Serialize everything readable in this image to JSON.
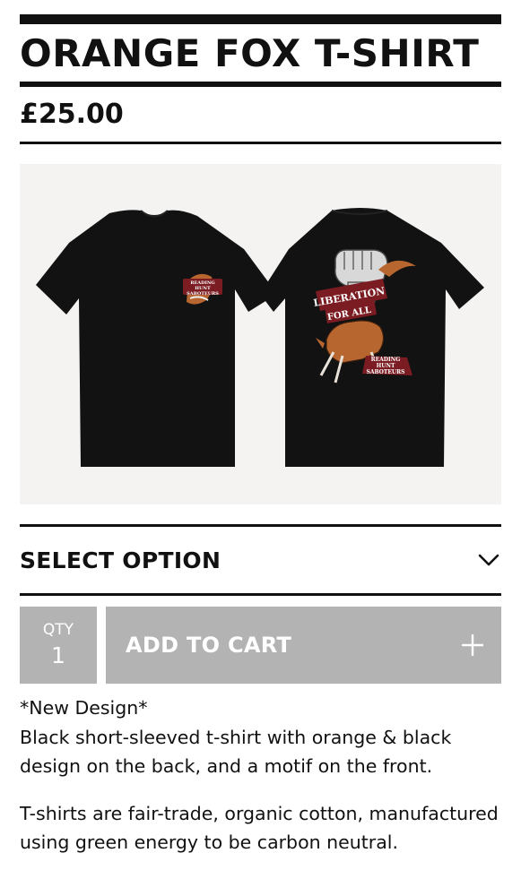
{
  "product": {
    "title": "ORANGE FOX T-SHIRT",
    "price": "£25.00",
    "image": {
      "front_patch": [
        "READING",
        "HUNT",
        "SABOTEURS"
      ],
      "back_banner": [
        "LIBERATION",
        "FOR ALL"
      ],
      "back_footer": [
        "READING",
        "HUNT",
        "SABOTEURS"
      ]
    }
  },
  "options": {
    "select_label": "SELECT OPTION",
    "chevron_icon": "chevron-down-icon"
  },
  "cart": {
    "qty_label": "QTY",
    "qty_value": "1",
    "add_label": "ADD TO CART",
    "add_icon": "plus-icon",
    "disabled_color": "#b3b3b3"
  },
  "description": {
    "line1": "*New Design*",
    "line2": "Black short-sleeved t-shirt with orange & black design on the back, and a motif on the front.",
    "para2": "T-shirts are fair-trade, organic cotton, manufactured using green energy to be carbon neutral."
  }
}
